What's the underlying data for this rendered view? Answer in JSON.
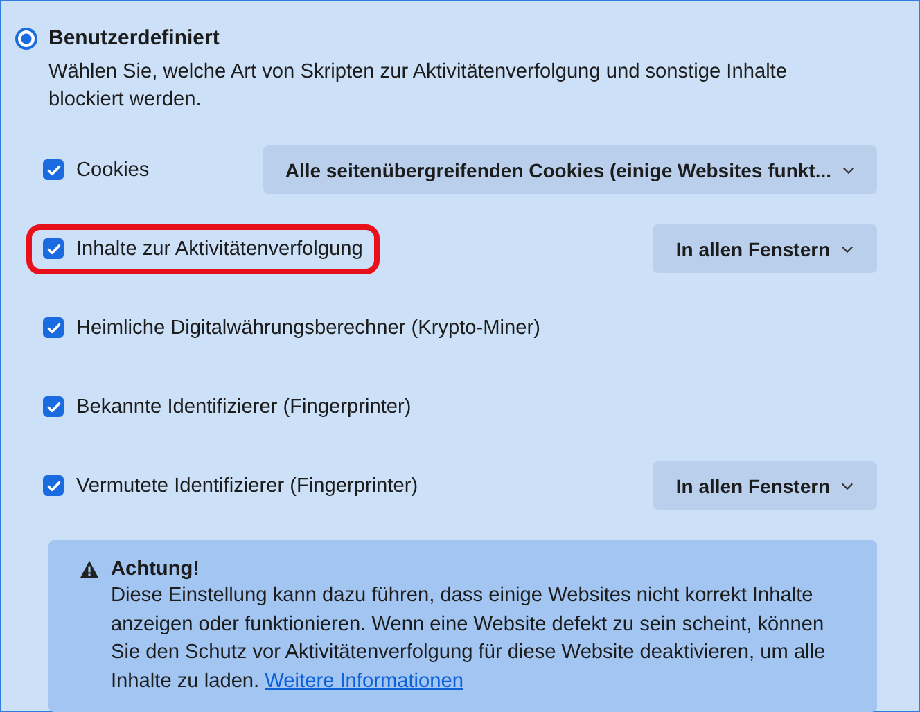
{
  "option": {
    "label": "Benutzerdefiniert",
    "selected": true,
    "description": "Wählen Sie, welche Art von Skripten zur Aktivitätenverfolgung und sonstige Inhalte blockiert werden."
  },
  "items": [
    {
      "label": "Cookies",
      "checked": true,
      "highlighted": false,
      "dropdown": "Alle seitenübergreifenden Cookies (einige Websites funkt..."
    },
    {
      "label": "Inhalte zur Aktivitätenverfolgung",
      "checked": true,
      "highlighted": true,
      "dropdown": "In allen Fenstern"
    },
    {
      "label": "Heimliche Digitalwährungsberechner (Krypto-Miner)",
      "checked": true,
      "highlighted": false
    },
    {
      "label": "Bekannte Identifizierer (Fingerprinter)",
      "checked": true,
      "highlighted": false
    },
    {
      "label": "Vermutete Identifizierer (Fingerprinter)",
      "checked": true,
      "highlighted": false,
      "dropdown": "In allen Fenstern"
    }
  ],
  "warning": {
    "title": "Achtung!",
    "text": "Diese Einstellung kann dazu führen, dass einige Websites nicht korrekt Inhalte anzeigen oder funktionieren. Wenn eine Website defekt zu sein scheint, können Sie den Schutz vor Aktivitätenverfolgung für diese Website deaktivieren, um alle Inhalte zu laden.",
    "link": "Weitere Informationen"
  }
}
